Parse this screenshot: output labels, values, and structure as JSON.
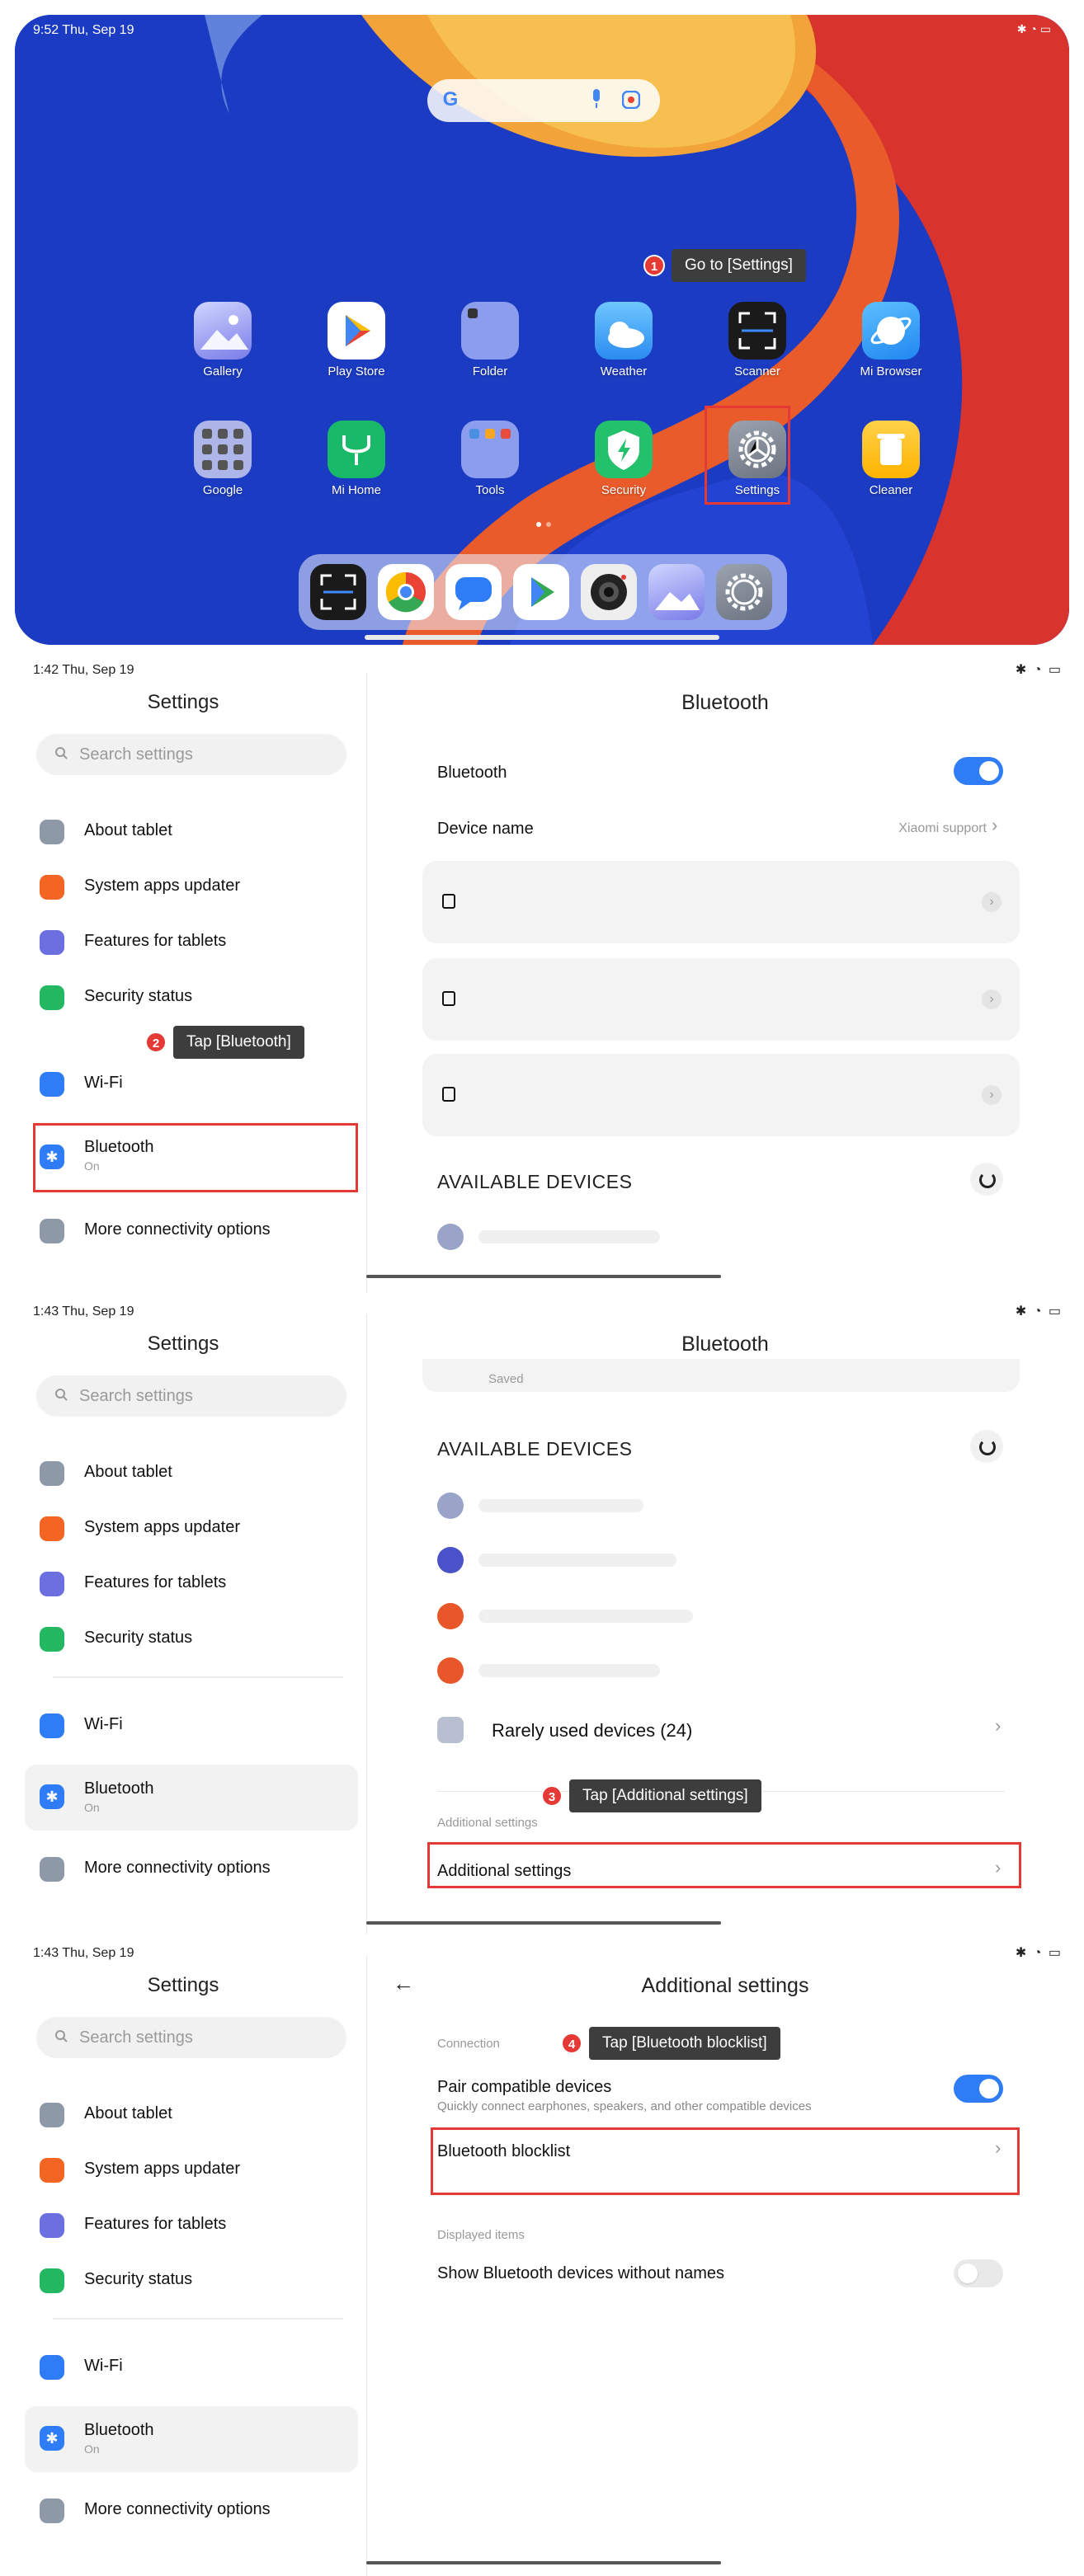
{
  "home": {
    "status_time": "9:52  Thu, Sep 19",
    "apps_row1": [
      "Gallery",
      "Play Store",
      "Folder",
      "Weather",
      "Scanner",
      "Mi Browser"
    ],
    "apps_row2": [
      "Google",
      "Mi Home",
      "Tools",
      "Security",
      "Settings",
      "Cleaner"
    ],
    "dock": [
      "Scanner",
      "Chrome",
      "Messages",
      "Play Store",
      "Camera",
      "Gallery",
      "Settings"
    ]
  },
  "steps": [
    {
      "num": "1",
      "text": "Go to [Settings]"
    },
    {
      "num": "2",
      "text": "Tap [Bluetooth]"
    },
    {
      "num": "3",
      "text": "Tap [Additional settings]"
    },
    {
      "num": "4",
      "text": "Tap [Bluetooth blocklist]"
    }
  ],
  "settings": {
    "title": "Settings",
    "search_placeholder": "Search settings",
    "items": {
      "about": "About tablet",
      "updater": "System apps updater",
      "features": "Features for tablets",
      "security": "Security status",
      "wifi": "Wi-Fi",
      "bluetooth": "Bluetooth",
      "bluetooth_sub": "On",
      "more": "More connectivity options"
    }
  },
  "panel2": {
    "status_time": "1:42  Thu, Sep 19",
    "title": "Bluetooth",
    "bluetooth_label": "Bluetooth",
    "device_name_label": "Device name",
    "device_name_value": "Xiaomi support",
    "available": "AVAILABLE DEVICES"
  },
  "panel3": {
    "status_time": "1:43  Thu, Sep 19",
    "title": "Bluetooth",
    "saved": "Saved",
    "available": "AVAILABLE DEVICES",
    "rarely": "Rarely used devices (24)",
    "additional_header": "Additional settings",
    "additional_row": "Additional settings"
  },
  "panel4": {
    "status_time": "1:43  Thu, Sep 19",
    "title": "Additional settings",
    "connection": "Connection",
    "pair_title": "Pair compatible devices",
    "pair_sub": "Quickly connect earphones, speakers, and other compatible devices",
    "blocklist": "Bluetooth blocklist",
    "displayed": "Displayed items",
    "show_names": "Show Bluetooth devices without names"
  },
  "colors": {
    "accent_blue": "#2f7df6",
    "callout_red": "#e53935",
    "callout_bg": "#3d3d3d"
  }
}
